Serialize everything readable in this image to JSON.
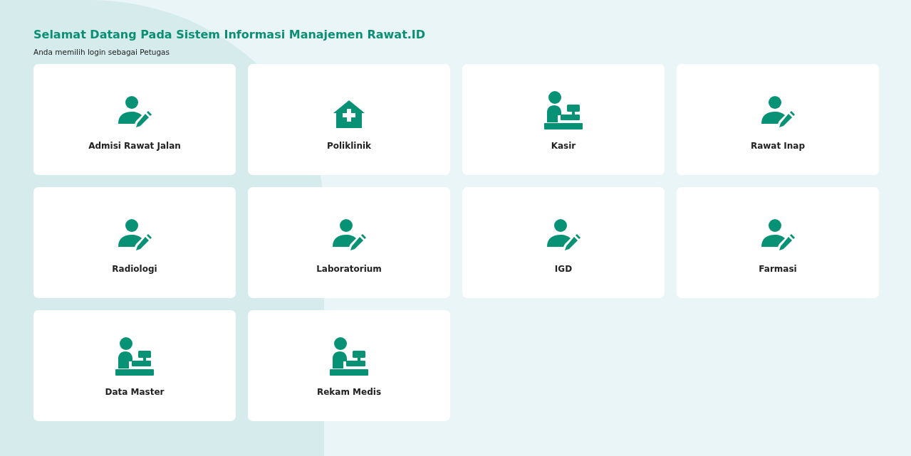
{
  "header": {
    "title": "Selamat Datang Pada Sistem Informasi Manajemen Rawat.ID",
    "subtitle": "Anda memilih login sebagai Petugas"
  },
  "modules": [
    {
      "label": "Admisi Rawat Jalan",
      "kind": "user-edit"
    },
    {
      "label": "Poliklinik",
      "kind": "hospital"
    },
    {
      "label": "Kasir",
      "kind": "cashier"
    },
    {
      "label": "Rawat Inap",
      "kind": "user-edit"
    },
    {
      "label": "Radiologi",
      "kind": "user-edit"
    },
    {
      "label": "Laboratorium",
      "kind": "user-edit"
    },
    {
      "label": "IGD",
      "kind": "user-edit"
    },
    {
      "label": "Farmasi",
      "kind": "user-edit"
    },
    {
      "label": "Data Master",
      "kind": "cashier"
    },
    {
      "label": "Rekam Medis",
      "kind": "cashier"
    }
  ]
}
